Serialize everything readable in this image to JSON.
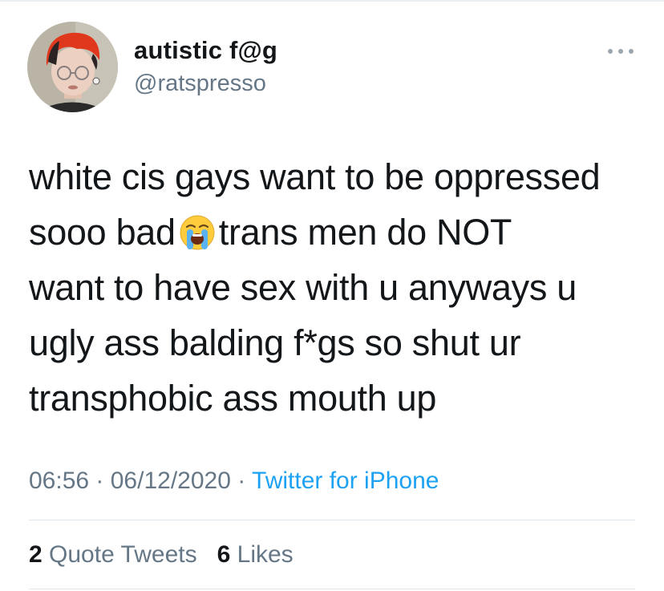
{
  "user": {
    "display_name": "autistic f@g",
    "handle": "@ratspresso"
  },
  "tweet": {
    "lines": [
      "white cis gays want to be oppressed",
      "sooo bad",
      "trans men do NOT",
      "want to have sex with u anyways u",
      "ugly ass balding f*gs so shut ur",
      "transphobic ass mouth up"
    ],
    "emoji": "loudly-crying-face-icon"
  },
  "meta": {
    "time": "06:56",
    "date": "06/12/2020",
    "separator": " · ",
    "source": "Twitter for iPhone"
  },
  "stats": {
    "quote_tweets_count": "2",
    "quote_tweets_label": "Quote Tweets",
    "likes_count": "6",
    "likes_label": "Likes"
  },
  "colors": {
    "text": "#14171a",
    "secondary": "#657786",
    "link": "#1da1f2",
    "divider": "#e1e8ed"
  }
}
